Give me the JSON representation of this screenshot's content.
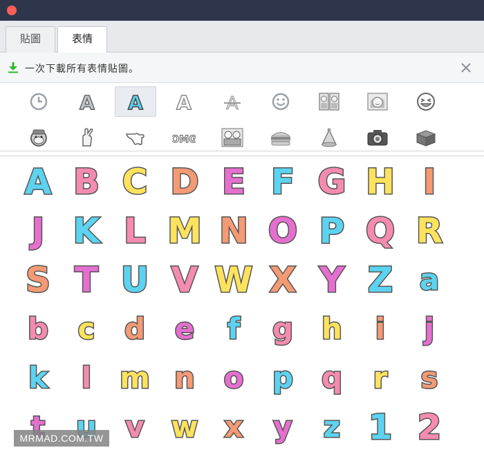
{
  "window": {
    "close_color": "#fe5f57",
    "titlebar_color": "#2e364c"
  },
  "tabs": [
    {
      "label": "貼圖"
    },
    {
      "label": "表情",
      "selected": true
    }
  ],
  "download_bar": {
    "text": "一次下載所有表情貼圖。",
    "icon": "download-icon",
    "close_icon": "close-icon"
  },
  "categories": {
    "row1": [
      "clock-icon",
      "letter-a-gray-icon",
      "letter-a-cyan-icon",
      "letter-a-outline-icon",
      "letter-a-strike-icon",
      "smiley-face-icon",
      "couple-icon",
      "girl-face-icon",
      "laughing-face-icon"
    ],
    "row2": [
      "monkey-face-icon",
      "crossed-fingers-icon",
      "pointing-hand-icon",
      "omg-text-icon",
      "comic-people-icon",
      "burger-icon",
      "party-hat-icon",
      "camera-icon",
      "gift-box-icon"
    ],
    "omg_text": "OMG",
    "selected": "letter-a-cyan-icon"
  },
  "stickers": [
    {
      "ch": "A",
      "color": "#5cd3f0"
    },
    {
      "ch": "B",
      "color": "#f58bb0"
    },
    {
      "ch": "C",
      "color": "#fde35d"
    },
    {
      "ch": "D",
      "color": "#f49a74"
    },
    {
      "ch": "E",
      "color": "#e56fcf"
    },
    {
      "ch": "F",
      "color": "#5cd3f0"
    },
    {
      "ch": "G",
      "color": "#f58bb0"
    },
    {
      "ch": "H",
      "color": "#fde35d"
    },
    {
      "ch": "I",
      "color": "#f49a74"
    },
    {
      "ch": "J",
      "color": "#e56fcf"
    },
    {
      "ch": "K",
      "color": "#5cd3f0"
    },
    {
      "ch": "L",
      "color": "#f58bb0"
    },
    {
      "ch": "M",
      "color": "#fde35d"
    },
    {
      "ch": "N",
      "color": "#f49a74"
    },
    {
      "ch": "O",
      "color": "#e56fcf"
    },
    {
      "ch": "P",
      "color": "#5cd3f0"
    },
    {
      "ch": "Q",
      "color": "#f58bb0"
    },
    {
      "ch": "R",
      "color": "#fde35d"
    },
    {
      "ch": "S",
      "color": "#f49a74"
    },
    {
      "ch": "T",
      "color": "#e56fcf"
    },
    {
      "ch": "U",
      "color": "#5cd3f0"
    },
    {
      "ch": "V",
      "color": "#f58bb0"
    },
    {
      "ch": "W",
      "color": "#fde35d"
    },
    {
      "ch": "X",
      "color": "#f49a74"
    },
    {
      "ch": "Y",
      "color": "#e56fcf"
    },
    {
      "ch": "Z",
      "color": "#5cd3f0"
    },
    {
      "ch": "a",
      "color": "#5cd3f0"
    },
    {
      "ch": "b",
      "color": "#f58bb0"
    },
    {
      "ch": "c",
      "color": "#fde35d"
    },
    {
      "ch": "d",
      "color": "#f49a74"
    },
    {
      "ch": "e",
      "color": "#e56fcf"
    },
    {
      "ch": "f",
      "color": "#5cd3f0"
    },
    {
      "ch": "g",
      "color": "#f58bb0"
    },
    {
      "ch": "h",
      "color": "#fde35d"
    },
    {
      "ch": "i",
      "color": "#f49a74"
    },
    {
      "ch": "j",
      "color": "#e56fcf"
    },
    {
      "ch": "k",
      "color": "#5cd3f0"
    },
    {
      "ch": "l",
      "color": "#f58bb0"
    },
    {
      "ch": "m",
      "color": "#fde35d"
    },
    {
      "ch": "n",
      "color": "#f49a74"
    },
    {
      "ch": "o",
      "color": "#e56fcf"
    },
    {
      "ch": "p",
      "color": "#5cd3f0"
    },
    {
      "ch": "q",
      "color": "#f58bb0"
    },
    {
      "ch": "r",
      "color": "#fde35d"
    },
    {
      "ch": "s",
      "color": "#f49a74"
    },
    {
      "ch": "t",
      "color": "#e56fcf"
    },
    {
      "ch": "u",
      "color": "#5cd3f0"
    },
    {
      "ch": "v",
      "color": "#f58bb0"
    },
    {
      "ch": "w",
      "color": "#fde35d"
    },
    {
      "ch": "x",
      "color": "#f49a74"
    },
    {
      "ch": "y",
      "color": "#e56fcf"
    },
    {
      "ch": "z",
      "color": "#5cd3f0"
    },
    {
      "ch": "1",
      "color": "#5cd3f0"
    },
    {
      "ch": "2",
      "color": "#f58bb0"
    }
  ],
  "watermark": "MRMAD.COM.TW"
}
